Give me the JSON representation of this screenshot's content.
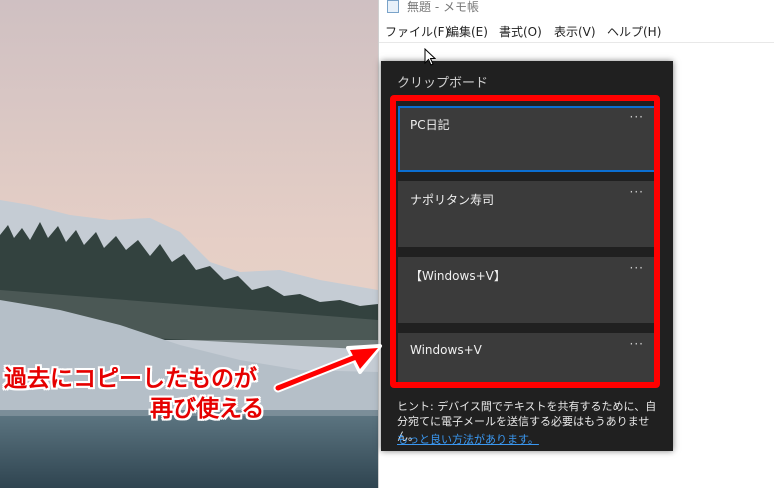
{
  "window": {
    "title": "無題 - メモ帳",
    "menu": [
      "ファイル(F)",
      "編集(E)",
      "書式(O)",
      "表示(V)",
      "ヘルプ(H)"
    ]
  },
  "clipboard": {
    "title": "クリップボード",
    "items": [
      {
        "text": "PC日記",
        "more": "···"
      },
      {
        "text": "ナポリタン寿司",
        "more": "···"
      },
      {
        "text": "【Windows+V】",
        "more": "···"
      },
      {
        "text": "Windows+V",
        "more": "···"
      }
    ],
    "hint": "ヒント: デバイス間でテキストを共有するために、自分宛てに電子メールを送信する必要はもうありません。",
    "link": "もっと良い方法があります。"
  },
  "annotation": {
    "line1": "過去にコピーしたものが",
    "line2": "再び使える",
    "color": "#e60000"
  },
  "colors": {
    "panel_bg": "#202020",
    "item_bg": "#3b3b3b",
    "highlight": "#ff0000",
    "selection": "#0b6ed1",
    "link": "#3a97f0"
  }
}
